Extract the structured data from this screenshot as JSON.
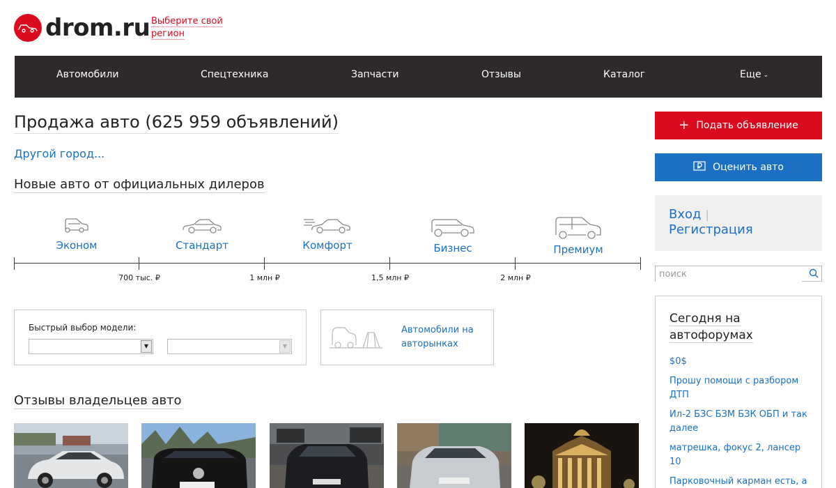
{
  "header": {
    "logo_text": "drom.ru",
    "region_link": "Выберите свой регион"
  },
  "nav": [
    {
      "label": "Автомобили"
    },
    {
      "label": "Спецтехника"
    },
    {
      "label": "Запчасти"
    },
    {
      "label": "Отзывы"
    },
    {
      "label": "Каталог"
    },
    {
      "label": "Еще"
    }
  ],
  "main": {
    "title": "Продажа авто (625 959 объявлений)",
    "other_city": "Другой город...",
    "new_cars_title": "Новые авто от официальных дилеров",
    "classes": [
      {
        "label": "Эконом",
        "icon": "economy-car-icon"
      },
      {
        "label": "Стандарт",
        "icon": "sedan-car-icon"
      },
      {
        "label": "Комфорт",
        "icon": "comfort-car-icon"
      },
      {
        "label": "Бизнес",
        "icon": "business-car-icon"
      },
      {
        "label": "Премиум",
        "icon": "premium-suv-icon"
      }
    ],
    "prices": [
      "700 тыс. ₽",
      "1 млн ₽",
      "1,5 млн ₽",
      "2 млн ₽"
    ],
    "quick_select_label": "Быстрый выбор модели:",
    "select_make_value": "",
    "select_model_value": "",
    "market_link": "Автомобили на авторынках",
    "reviews_title": "Отзывы владельцев авто"
  },
  "sidebar": {
    "add_ad": "Подать объявление",
    "rate_car": "Оценить авто",
    "login": "Вход",
    "register": "Регистрация",
    "search_placeholder": "поиск",
    "forum_title": "Сегодня на автофорумах",
    "forum_items": [
      "$0$",
      "Прошу помощи с разбором ДТП",
      "Ил-2 БЗС БЗМ БЗК ОБП и так далее",
      "матрешка, фокус 2, лансер 10",
      "Парковочный карман есть, а"
    ]
  },
  "colors": {
    "brand_red": "#db0a1d",
    "link_blue": "#1c70c3",
    "nav_bg": "#2e2a2a"
  }
}
